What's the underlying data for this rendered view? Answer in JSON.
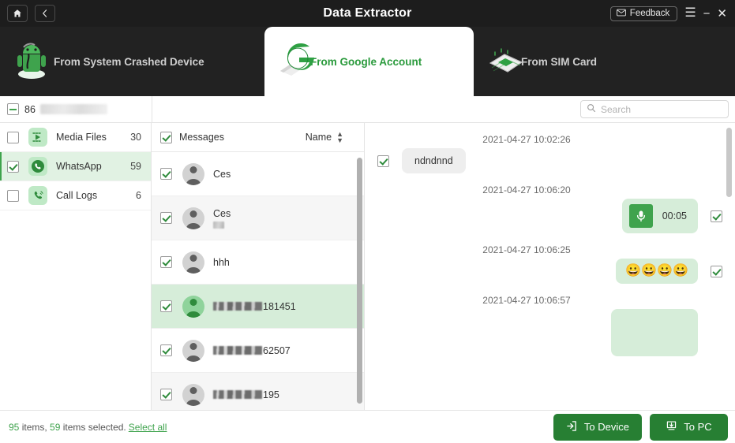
{
  "titlebar": {
    "home_icon": "home-icon",
    "back_icon": "chevron-left-icon",
    "title": "Data Extractor",
    "feedback_label": "Feedback",
    "feedback_icon": "envelope-icon",
    "menu_icon": "hamburger-icon",
    "minimize_icon": "minimize-icon",
    "close_icon": "close-icon"
  },
  "tabs": [
    {
      "label": "From System Crashed Device",
      "icon": "android-robot-icon",
      "active": false
    },
    {
      "label": "From Google Account",
      "icon": "google-g-icon",
      "active": true
    },
    {
      "label": "From SIM Card",
      "icon": "sim-card-icon",
      "active": false
    }
  ],
  "device_bar": {
    "count": "86",
    "device_name_redacted": true,
    "checkbox_state": "indeterminate"
  },
  "search": {
    "placeholder": "Search",
    "value": "",
    "icon": "search-icon"
  },
  "sidebar": {
    "items": [
      {
        "label": "Media Files",
        "count": "30",
        "checked": false,
        "selected": false,
        "icon": "media-play-icon"
      },
      {
        "label": "WhatsApp",
        "count": "59",
        "checked": true,
        "selected": true,
        "icon": "whatsapp-icon"
      },
      {
        "label": "Call Logs",
        "count": "6",
        "checked": false,
        "selected": false,
        "icon": "call-log-icon"
      }
    ]
  },
  "message_list": {
    "header": {
      "title": "Messages",
      "checked": true,
      "sort_label": "Name",
      "sort_icon": "sort-updown-icon"
    },
    "rows": [
      {
        "name": "Ces",
        "checked": true,
        "redacted_sub": false,
        "masked_prefix": false,
        "selected": false,
        "avatar": "grey"
      },
      {
        "name": "Ces",
        "checked": true,
        "redacted_sub": true,
        "masked_prefix": false,
        "selected": false,
        "avatar": "grey"
      },
      {
        "name": "hhh",
        "checked": true,
        "redacted_sub": false,
        "masked_prefix": false,
        "selected": false,
        "avatar": "grey"
      },
      {
        "name": "181451",
        "checked": true,
        "redacted_sub": false,
        "masked_prefix": true,
        "selected": true,
        "avatar": "green"
      },
      {
        "name": "62507",
        "checked": true,
        "redacted_sub": false,
        "masked_prefix": true,
        "selected": false,
        "avatar": "grey"
      },
      {
        "name": "195",
        "checked": true,
        "redacted_sub": false,
        "masked_prefix": true,
        "selected": false,
        "avatar": "grey"
      }
    ]
  },
  "chat": {
    "entries": [
      {
        "timestamp": "2021-04-27 10:02:26",
        "side": "in",
        "kind": "text",
        "text": "ndndnnd",
        "checked": true
      },
      {
        "timestamp": "2021-04-27 10:06:20",
        "side": "out",
        "kind": "voice",
        "duration": "00:05",
        "icon": "microphone-icon",
        "checked": true
      },
      {
        "timestamp": "2021-04-27 10:06:25",
        "side": "out",
        "kind": "emoji",
        "emojis": "😀😀😀😀",
        "checked": true
      },
      {
        "timestamp": "2021-04-27 10:06:57",
        "side": "out",
        "kind": "image",
        "checked": false
      }
    ]
  },
  "footer": {
    "total_items": "95",
    "items_word_1": " items, ",
    "selected_items": "59",
    "items_word_2": " items selected.",
    "select_all_label": "Select all",
    "to_device_label": "To Device",
    "to_device_icon": "export-to-device-icon",
    "to_pc_label": "To PC",
    "to_pc_icon": "download-to-pc-icon"
  },
  "colors": {
    "accent_green": "#3fa34d",
    "button_green": "#277f33",
    "selected_row": "#d6edd9",
    "titlebar_dark": "#1d1d1d",
    "tabstrip_dark": "#222222"
  }
}
